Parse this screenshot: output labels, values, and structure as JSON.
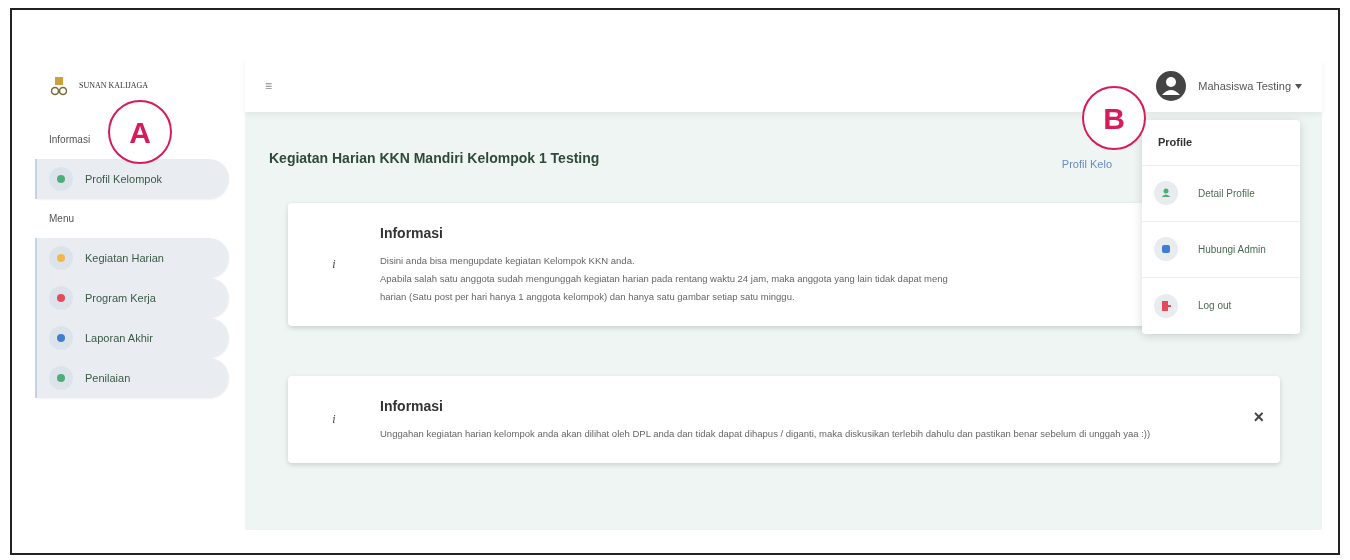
{
  "logo": {
    "text": "SUNAN KALIJAGA"
  },
  "sidebar": {
    "sections": [
      {
        "heading": "Informasi",
        "items": [
          {
            "label": "Profil Kelompok",
            "color": "#4caf7a"
          }
        ]
      },
      {
        "heading": "Menu",
        "items": [
          {
            "label": "Kegiatan Harian",
            "color": "#f2b84b"
          },
          {
            "label": "Program Kerja",
            "color": "#e24b5a"
          },
          {
            "label": "Laporan Akhir",
            "color": "#3f7fd0"
          },
          {
            "label": "Penilaian",
            "color": "#4caf7a"
          }
        ]
      }
    ]
  },
  "topbar": {
    "menu_glyph": "≡",
    "user": "Mahasiswa Testing"
  },
  "page_title": "Kegiatan Harian KKN Mandiri Kelompok 1 Testing",
  "header_link": "Profil Kelo",
  "cards": [
    {
      "icon": "i",
      "title": "Informasi",
      "lines": [
        "Disini anda bisa mengupdate kegiatan Kelompok KKN anda.",
        "Apabila salah satu anggota sudah mengunggah kegiatan harian pada rentang waktu 24 jam, maka anggota yang lain tidak dapat meng",
        "harian (Satu post per hari hanya 1 anggota kelompok) dan hanya satu gambar setiap satu minggu."
      ],
      "closable": false
    },
    {
      "icon": "i",
      "title": "Informasi",
      "lines": [
        "Unggahan kegiatan harian kelompok anda akan dilihat oleh DPL anda dan tidak dapat dihapus / diganti, maka diskusikan terlebih dahulu dan pastikan benar sebelum di unggah yaa :))"
      ],
      "closable": true,
      "close_glyph": "×"
    }
  ],
  "dropdown": {
    "title": "Profile",
    "items": [
      {
        "label": "Detail Profile",
        "kind": "person",
        "color": "#4caf7a"
      },
      {
        "label": "Hubungi Admin",
        "kind": "contact",
        "color": "#3f7fd0"
      },
      {
        "label": "Log out",
        "kind": "logout",
        "color": "#e24b5a"
      }
    ]
  },
  "callouts": [
    "A",
    "B"
  ]
}
